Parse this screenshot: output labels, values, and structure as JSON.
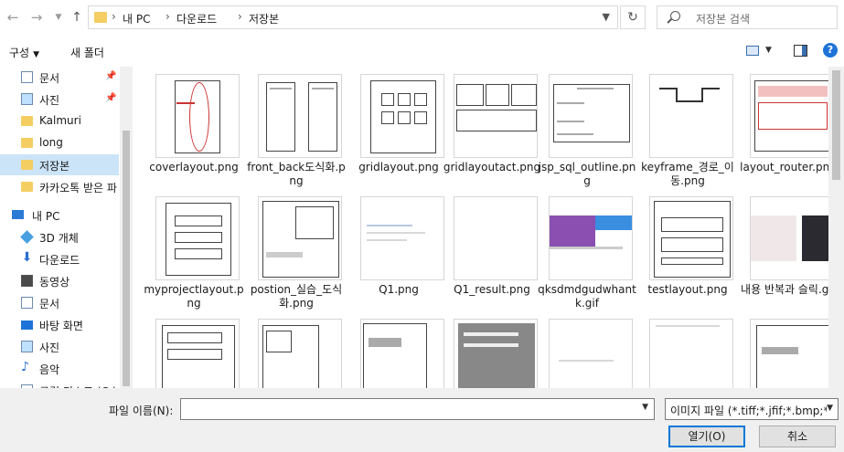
{
  "address": {
    "crumbs": [
      "내 PC",
      "다운로드",
      "저장본"
    ],
    "search_placeholder": "저장본 검색"
  },
  "toolbar": {
    "organize": "구성",
    "new_folder": "새 폴더"
  },
  "sidebar": {
    "items": [
      {
        "label": "문서",
        "icon": "document-icon",
        "pinned": true
      },
      {
        "label": "사진",
        "icon": "pictures-icon",
        "pinned": true
      },
      {
        "label": "Kalmuri",
        "icon": "folder-icon"
      },
      {
        "label": "long",
        "icon": "folder-icon"
      },
      {
        "label": "저장본",
        "icon": "folder-icon",
        "selected": true
      },
      {
        "label": "카카오톡 받은 파",
        "icon": "folder-icon"
      },
      {
        "label": "내 PC",
        "icon": "pc-icon"
      },
      {
        "label": "3D 개체",
        "icon": "3d-objects-icon"
      },
      {
        "label": "다운로드",
        "icon": "download-icon"
      },
      {
        "label": "동영상",
        "icon": "video-icon"
      },
      {
        "label": "문서",
        "icon": "document-icon"
      },
      {
        "label": "바탕 화면",
        "icon": "desktop-icon"
      },
      {
        "label": "사진",
        "icon": "pictures-icon"
      },
      {
        "label": "음악",
        "icon": "music-icon"
      },
      {
        "label": "로컬 디스크 (C:)",
        "icon": "drive-icon"
      }
    ]
  },
  "files": [
    "coverlayout.png",
    "front_back도식화.png",
    "gridlayout.png",
    "gridlayoutact.png",
    "jsp_sql_outline.png",
    "keyframe_경로_이동.png",
    "layout_router.png",
    "myprojectlayout.png",
    "postion_실습_도식화.png",
    "Q1.png",
    "Q1_result.png",
    "qksdmdgudwhantk.gif",
    "testlayout.png",
    "내용 반복과 슬릭.gif",
    "",
    "",
    "",
    "",
    "",
    "",
    ""
  ],
  "footer": {
    "filename_label": "파일 이름(N):",
    "filename_value": "",
    "filter": "이미지 파일 (*.tiff;*.jfif;*.bmp;*",
    "open": "열기(O)",
    "cancel": "취소"
  }
}
